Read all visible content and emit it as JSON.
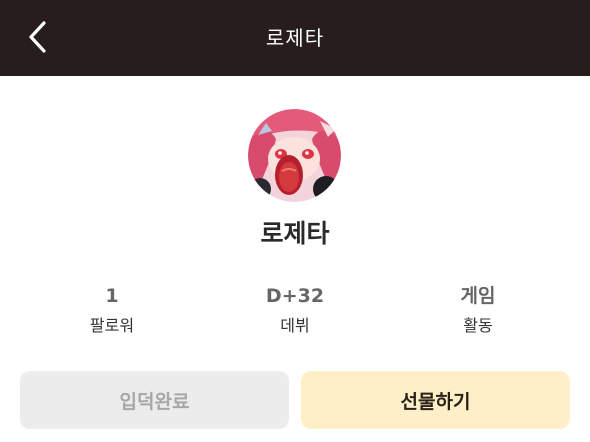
{
  "header": {
    "title": "로제타",
    "back_icon": "chevron-left-icon"
  },
  "profile": {
    "name": "로제타",
    "avatar_icon": "avatar-image"
  },
  "stats": [
    {
      "value": "1",
      "label": "팔로워"
    },
    {
      "value": "D+32",
      "label": "데뷔"
    },
    {
      "value": "게임",
      "label": "활동"
    }
  ],
  "actions": {
    "join_label": "입덕완료",
    "gift_label": "선물하기"
  },
  "colors": {
    "header_bg": "#271d1d",
    "gift_button_bg": "#fdf0c9",
    "join_button_bg": "#ececec"
  }
}
